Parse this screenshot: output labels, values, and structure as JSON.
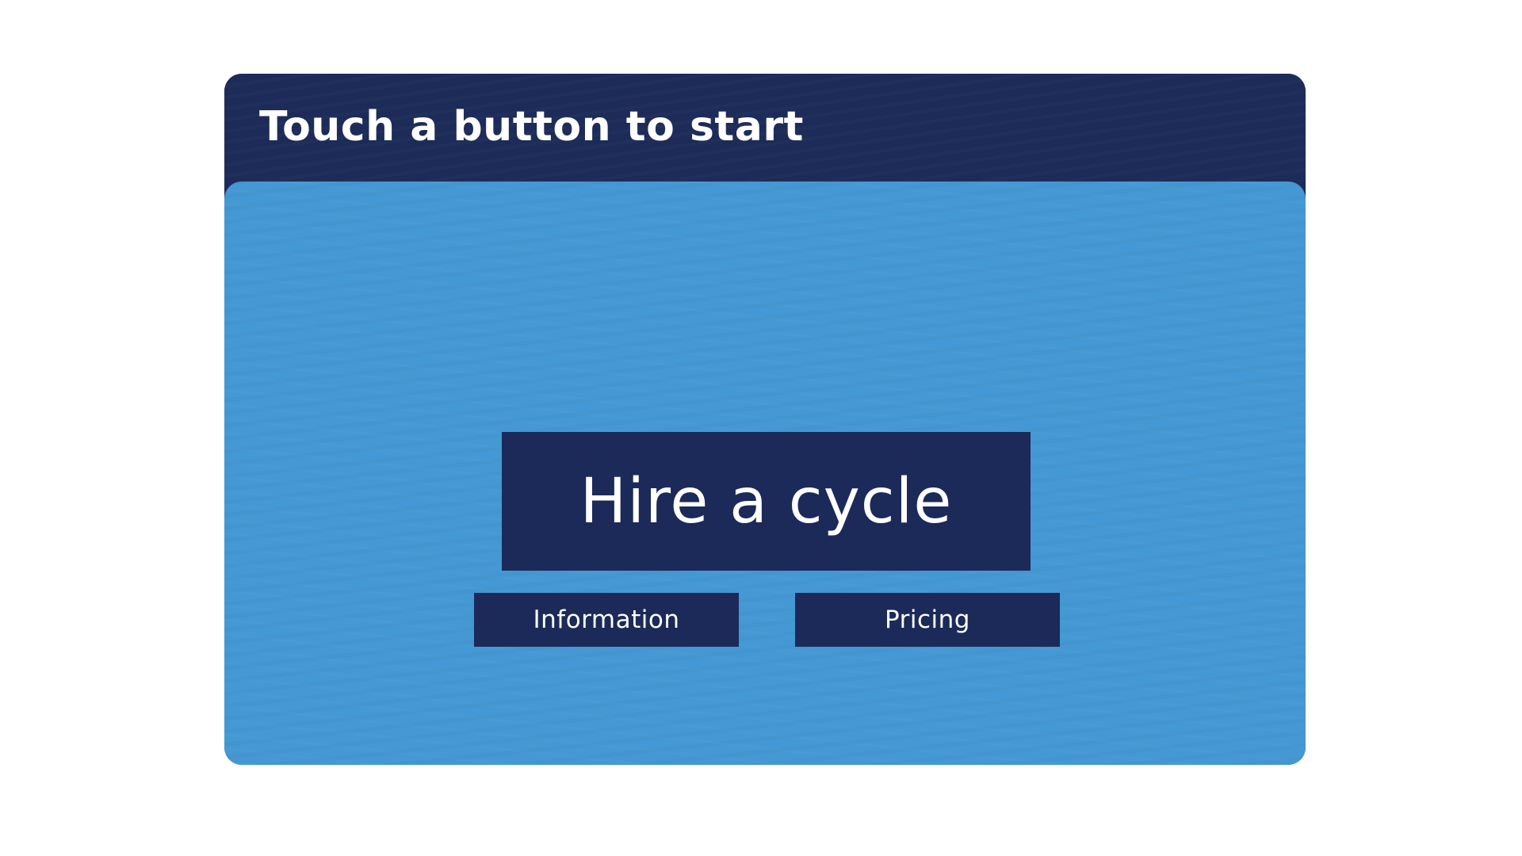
{
  "header": {
    "title": "Touch a button to start"
  },
  "buttons": {
    "primary_label": "Hire a cycle",
    "information_label": "Information",
    "pricing_label": "Pricing"
  },
  "colors": {
    "header_background": "#1d2b58",
    "panel_background": "#4498d3",
    "button_background": "#1b2a58",
    "text": "#ffffff",
    "page_background": "#ffffff"
  }
}
